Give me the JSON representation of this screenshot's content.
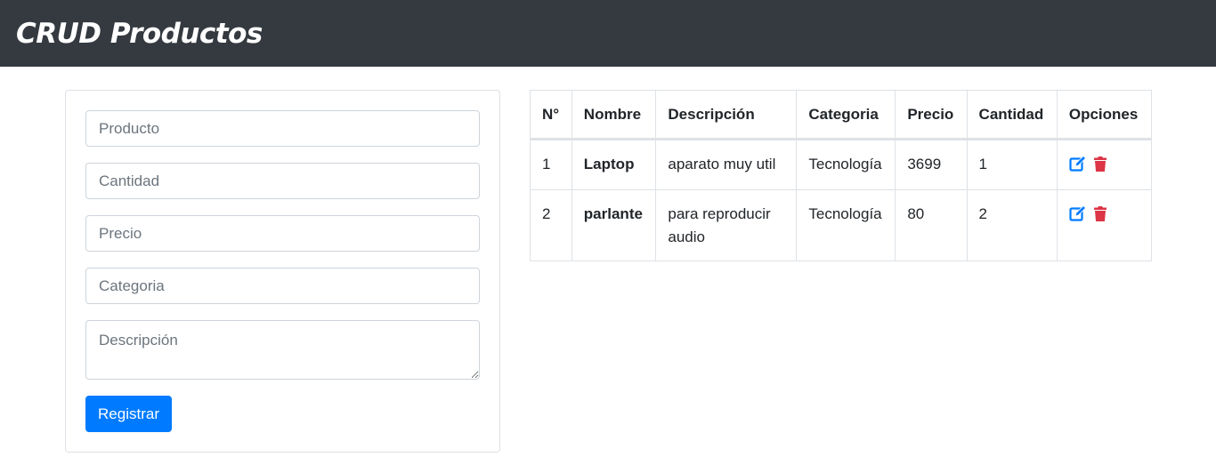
{
  "navbar": {
    "title": "CRUD Productos"
  },
  "form": {
    "producto_placeholder": "Producto",
    "cantidad_placeholder": "Cantidad",
    "precio_placeholder": "Precio",
    "categoria_placeholder": "Categoria",
    "descripcion_placeholder": "Descripción",
    "submit_label": "Registrar"
  },
  "table": {
    "headers": [
      "N°",
      "Nombre",
      "Descripción",
      "Categoria",
      "Precio",
      "Cantidad",
      "Opciones"
    ],
    "rows": [
      {
        "n": "1",
        "nombre": "Laptop",
        "descripcion": "aparato muy util",
        "categoria": "Tecnología",
        "precio": "3699",
        "cantidad": "1"
      },
      {
        "n": "2",
        "nombre": "parlante",
        "descripcion": "para reproducir audio",
        "categoria": "Tecnología",
        "precio": "80",
        "cantidad": "2"
      }
    ]
  },
  "icons": {
    "edit": "edit-icon",
    "delete": "trash-icon"
  },
  "colors": {
    "navbar": "#343a40",
    "primary": "#007bff",
    "edit": "#007bff",
    "delete": "#dc3545"
  }
}
